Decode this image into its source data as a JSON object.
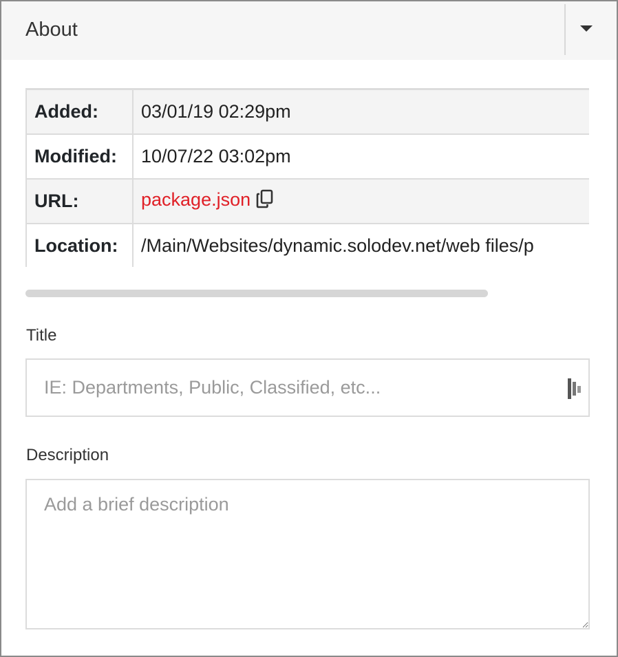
{
  "panel": {
    "title": "About",
    "toggle_icon": "caret-down-icon"
  },
  "info": {
    "rows": [
      {
        "key": "Added:",
        "value": "03/01/19 02:29pm"
      },
      {
        "key": "Modified:",
        "value": "10/07/22 03:02pm"
      },
      {
        "key": "URL:",
        "value": "package.json",
        "link_color": "#e02027",
        "action_icon": "copy-icon"
      },
      {
        "key": "Location:",
        "value": "/Main/Websites/dynamic.solodev.net/web files/p"
      }
    ]
  },
  "form": {
    "title_label": "Title",
    "title_placeholder": "IE: Departments, Public, Classified, etc...",
    "title_value": "",
    "title_icon": "translate-icon",
    "description_label": "Description",
    "description_placeholder": "Add a brief description",
    "description_value": ""
  },
  "colors": {
    "header_bg": "#f6f6f6",
    "link": "#e02027",
    "border": "#dcdcdc"
  }
}
